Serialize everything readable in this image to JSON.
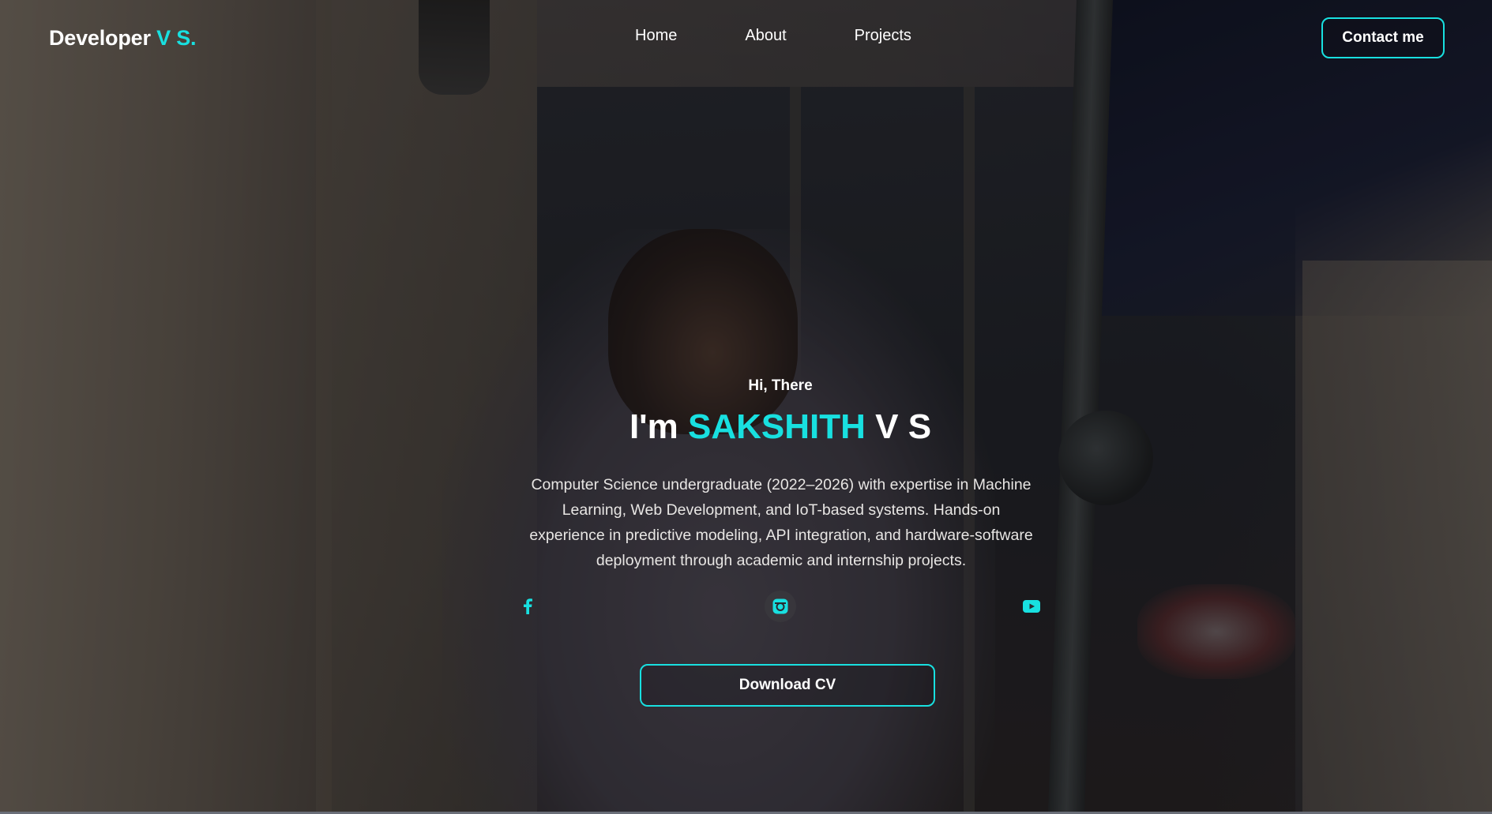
{
  "header": {
    "logo_main": "Developer",
    "logo_accent": "V S.",
    "nav": [
      {
        "label": "Home"
      },
      {
        "label": "About"
      },
      {
        "label": "Projects"
      }
    ],
    "contact_label": "Contact me"
  },
  "hero": {
    "greeting": "Hi, There",
    "title_prefix": "I'm",
    "title_accent": "SAKSHITH",
    "title_suffix": "V S",
    "description": "Computer Science undergraduate (2022–2026) with expertise in Machine Learning, Web Development, and IoT-based systems. Hands-on experience in predictive modeling, API integration, and hardware-software deployment through academic and internship projects.",
    "socials": [
      {
        "icon": "facebook-icon"
      },
      {
        "icon": "instagram-icon"
      },
      {
        "icon": "youtube-icon"
      }
    ],
    "download_label": "Download CV"
  },
  "colors": {
    "accent": "#18e0e0",
    "text": "#ffffff"
  }
}
